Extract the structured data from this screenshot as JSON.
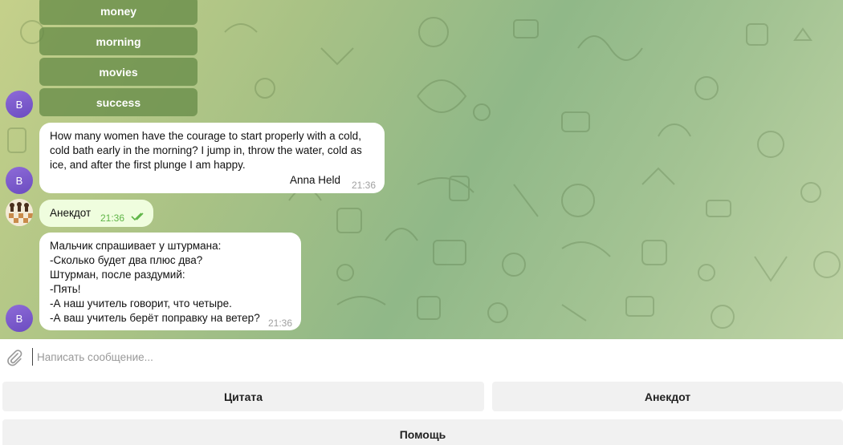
{
  "inline_keyboard": {
    "buttons": [
      "money",
      "morning",
      "movies",
      "success"
    ]
  },
  "messages": [
    {
      "text": "How many women have the courage to start properly with a cold,\ncold bath early in the morning? I jump in, throw the water, cold as\nice, and after the first plunge I am happy.",
      "author": "Anna Held",
      "time": "21:36"
    },
    {
      "text": "Анекдот",
      "time": "21:36"
    },
    {
      "text": "Мальчик спрашивает у штурмана:\n-Сколько будет два плюс два?\nШтурман, после раздумий:\n-Пять!\n-А наш учитель говорит, что четыре.\n-А ваш учитель берёт поправку на ветер?",
      "time": "21:36"
    }
  ],
  "avatars": {
    "bot_letter": "B"
  },
  "composer": {
    "placeholder": "Написать сообщение..."
  },
  "reply_keyboard": {
    "quote": "Цитата",
    "joke": "Анекдот",
    "help": "Помощь"
  },
  "colors": {
    "avatar": "#7c5bcc",
    "read_check": "#5fb548",
    "outgoing_bubble": "#effdde"
  }
}
